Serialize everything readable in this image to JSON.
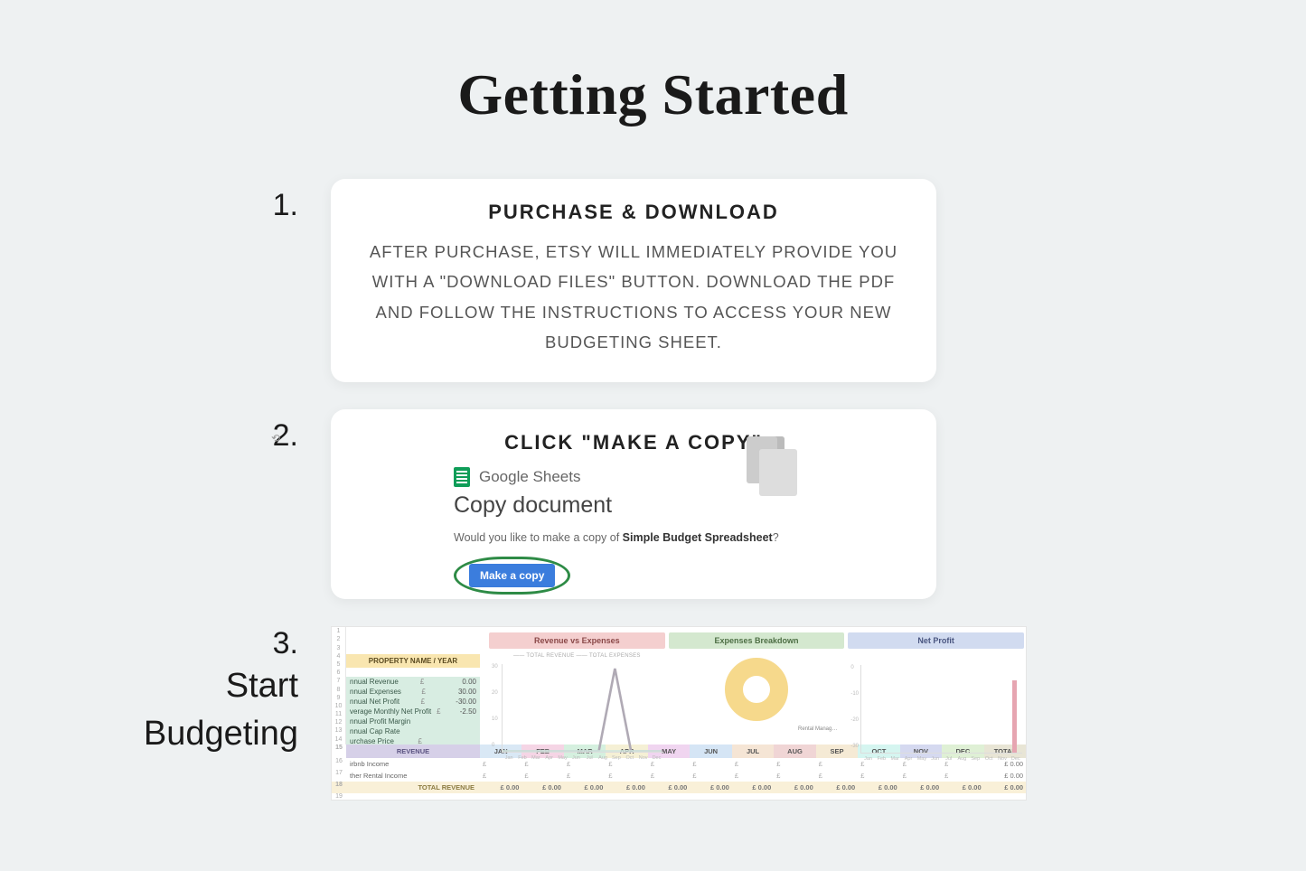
{
  "title": "Getting Started",
  "steps": {
    "one": {
      "num": "1.",
      "heading": "PURCHASE & DOWNLOAD",
      "body": "AFTER PURCHASE, ETSY WILL IMMEDIATELY PROVIDE YOU WITH A \"DOWNLOAD FILES\" BUTTON. DOWNLOAD THE PDF AND FOLLOW THE INSTRUCTIONS TO ACCESS YOUR NEW BUDGETING SHEET."
    },
    "two": {
      "num": "2.",
      "heading": "CLICK \"MAKE A COPY\"",
      "gs_label": "Google Sheets",
      "copy_label": "Copy document",
      "question_pre": "Would you like to make a copy of ",
      "question_bold": "Simple Budget Spreadsheet",
      "question_post": "?",
      "button": "Make a copy"
    },
    "three": {
      "num": "3.",
      "label_l1": "Start",
      "label_l2": "Budgeting"
    }
  },
  "sheet": {
    "prop_header": "PROPERTY NAME / YEAR",
    "metrics": [
      {
        "name": "nnual Revenue",
        "cur": "£",
        "val": "0.00"
      },
      {
        "name": "nnual Expenses",
        "cur": "£",
        "val": "30.00"
      },
      {
        "name": "nnual Net Profit",
        "cur": "£",
        "val": "-30.00"
      },
      {
        "name": "verage Monthly Net Profit",
        "cur": "£",
        "val": "-2.50"
      },
      {
        "name": "nnual Profit Margin",
        "cur": "",
        "val": ""
      },
      {
        "name": "nnual Cap Rate",
        "cur": "",
        "val": ""
      },
      {
        "name": "urchase Price",
        "cur": "£",
        "val": ""
      }
    ],
    "charts": {
      "rev_exp": {
        "title": "Revenue vs Expenses",
        "legend": "—— TOTAL REVENUE    —— TOTAL EXPENSES",
        "y": [
          "30",
          "20",
          "10",
          "0"
        ]
      },
      "breakdown": {
        "title": "Expenses Breakdown",
        "label": "Rental Manag…"
      },
      "net": {
        "title": "Net Profit",
        "y": [
          "0",
          "-10",
          "-20",
          "-30"
        ]
      }
    },
    "months_short": [
      "Jan",
      "Feb",
      "Mar",
      "Apr",
      "May",
      "Jun",
      "Jul",
      "Aug",
      "Sep",
      "Oct",
      "Nov",
      "Dec"
    ],
    "month_headers": {
      "revenue": "REVENUE",
      "cols": [
        "JAN",
        "FEB",
        "MAR",
        "APR",
        "MAY",
        "JUN",
        "JUL",
        "AUG",
        "SEP",
        "OCT",
        "NOV",
        "DEC",
        "TOTAL"
      ]
    },
    "income_rows": [
      {
        "label": "irbnb Income",
        "cells": [
          "£",
          "£",
          "£",
          "£",
          "£",
          "£",
          "£",
          "£",
          "£",
          "£",
          "£",
          "£"
        ],
        "total": "£    0.00"
      },
      {
        "label": "ther Rental Income",
        "cells": [
          "£",
          "£",
          "£",
          "£",
          "£",
          "£",
          "£",
          "£",
          "£",
          "£",
          "£",
          "£"
        ],
        "total": "£    0.00"
      }
    ],
    "total_row": {
      "label": "TOTAL REVENUE",
      "cells": [
        "£   0.00",
        "£   0.00",
        "£   0.00",
        "£   0.00",
        "£   0.00",
        "£   0.00",
        "£   0.00",
        "£   0.00",
        "£   0.00",
        "£   0.00",
        "£   0.00",
        "£   0.00"
      ],
      "total": "£    0.00"
    }
  },
  "chart_data": [
    {
      "type": "line",
      "title": "Revenue vs Expenses",
      "categories": [
        "Jan",
        "Feb",
        "Mar",
        "Apr",
        "May",
        "Jun",
        "Jul",
        "Aug",
        "Sep",
        "Oct",
        "Nov",
        "Dec"
      ],
      "series": [
        {
          "name": "TOTAL REVENUE",
          "values": [
            0,
            0,
            0,
            0,
            0,
            0,
            0,
            0,
            0,
            0,
            0,
            0
          ]
        },
        {
          "name": "TOTAL EXPENSES",
          "values": [
            0,
            0,
            0,
            0,
            0,
            0,
            0,
            0,
            30,
            0,
            0,
            0
          ]
        }
      ],
      "ylabel": "",
      "xlabel": "",
      "ylim": [
        0,
        30
      ]
    },
    {
      "type": "pie",
      "title": "Expenses Breakdown",
      "categories": [
        "Rental Manag…"
      ],
      "values": [
        30
      ]
    },
    {
      "type": "bar",
      "title": "Net Profit",
      "categories": [
        "Jan",
        "Feb",
        "Mar",
        "Apr",
        "May",
        "Jun",
        "Jul",
        "Aug",
        "Sep",
        "Oct",
        "Nov",
        "Dec"
      ],
      "values": [
        0,
        0,
        0,
        0,
        0,
        0,
        0,
        0,
        0,
        0,
        0,
        -30
      ],
      "ylim": [
        -30,
        0
      ]
    }
  ]
}
